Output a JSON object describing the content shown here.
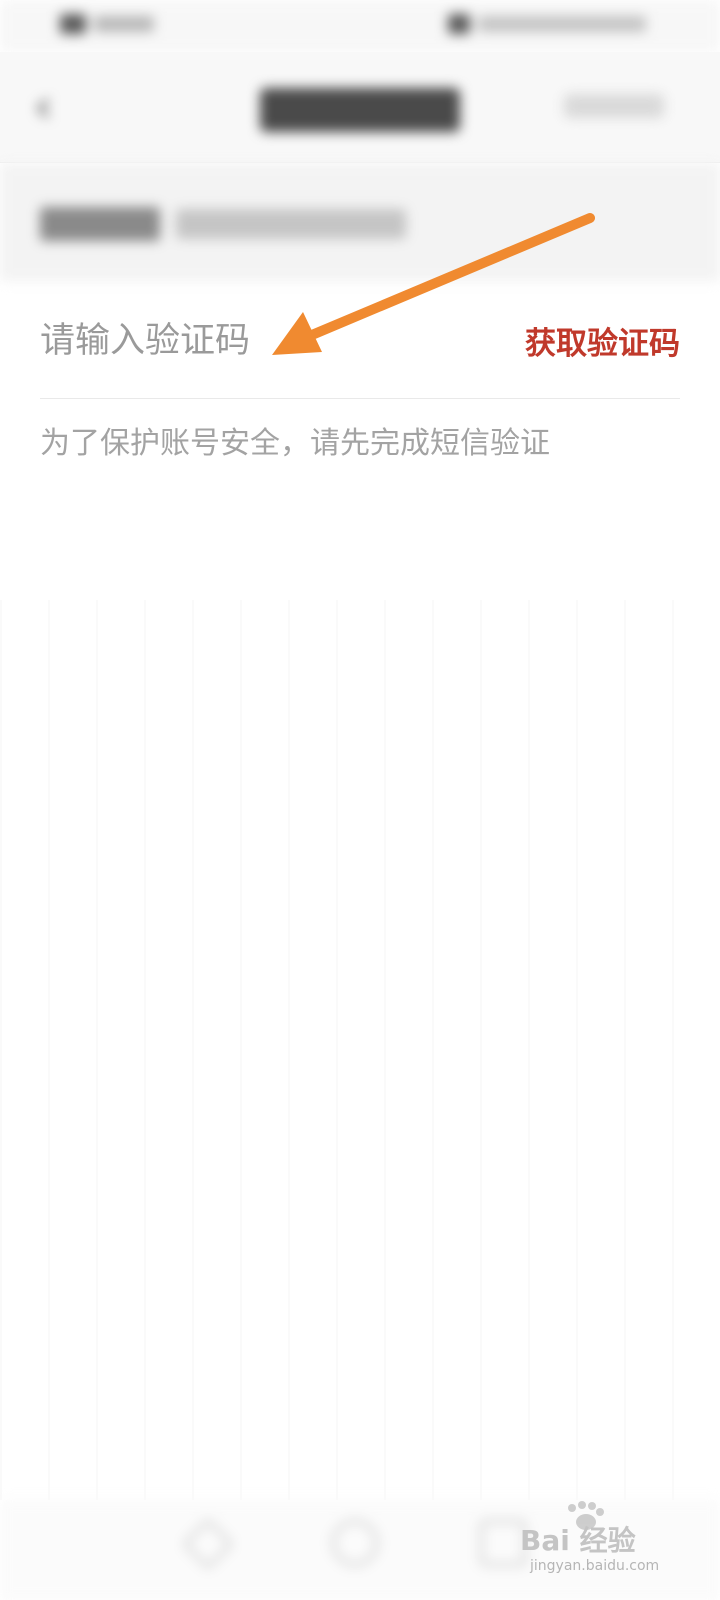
{
  "verify": {
    "code_placeholder": "请输入验证码",
    "get_code_label": "获取验证码",
    "hint": "为了保护账号安全，请先完成短信验证"
  },
  "colors": {
    "accent": "#c0392b",
    "arrow": "#f08a30",
    "placeholder": "#9a9a9a",
    "hint": "#a3a3a3"
  },
  "icons": {
    "back": "chevron-left-icon"
  },
  "watermark": {
    "brand": "Bai 经验",
    "domain": "jingyan.baidu.com"
  }
}
